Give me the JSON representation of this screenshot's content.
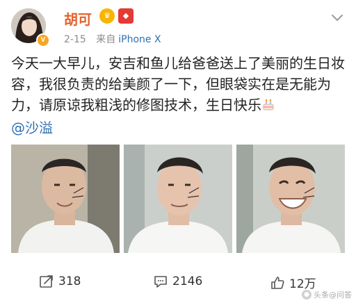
{
  "user": {
    "name": "胡可",
    "date": "2-15",
    "source_prefix": "来自",
    "source": "iPhone X",
    "avatar_icon": "profile-photo",
    "verified_badge": "V"
  },
  "post": {
    "text": "今天一大早儿，安吉和鱼儿给爸爸送上了美丽的生日妆容，我很负责的给美颜了一下，但眼袋实在是无能为力，请原谅我粗浅的修图技术，生日快乐",
    "mention": "@沙溢",
    "emoji": "birthday-cake-icon"
  },
  "actions": {
    "repost_count": "318",
    "comment_count": "2146",
    "like_count": "12万"
  },
  "watermark": {
    "text": "头条@问答"
  },
  "colors": {
    "username": "#e6612b",
    "link": "#2f6fb0",
    "meta": "#8a8a8a"
  }
}
